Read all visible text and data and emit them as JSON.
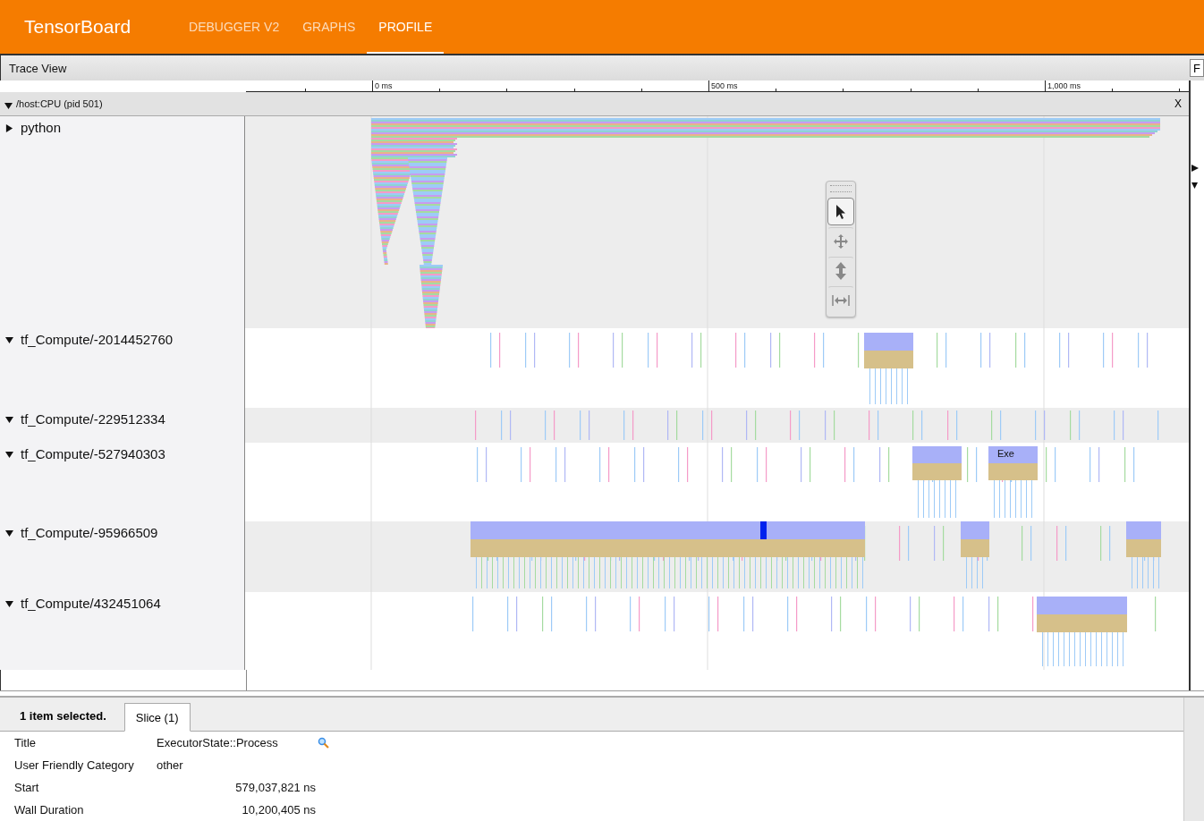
{
  "app": {
    "title": "TensorBoard",
    "tabs": [
      {
        "label": "DEBUGGER V2",
        "selected": false
      },
      {
        "label": "GRAPHS",
        "selected": false
      },
      {
        "label": "PROFILE",
        "selected": true
      }
    ]
  },
  "trace_view": {
    "title": "Trace View",
    "side_button": "F",
    "ruler_ticks": [
      "0 ms",
      "500 ms",
      "1,000 ms"
    ],
    "process": {
      "label": "/host:CPU (pid 501)",
      "expanded": true,
      "close": "X"
    },
    "threads": [
      {
        "name": "python",
        "expanded": false
      },
      {
        "name": "tf_Compute/-2014452760",
        "expanded": true
      },
      {
        "name": "tf_Compute/-229512334",
        "expanded": true
      },
      {
        "name": "tf_Compute/-527940303",
        "expanded": true,
        "slice_label": "Exe"
      },
      {
        "name": "tf_Compute/-95966509",
        "expanded": true
      },
      {
        "name": "tf_Compute/432451064",
        "expanded": true
      }
    ],
    "tools": [
      {
        "kind": "select",
        "selected": true
      },
      {
        "kind": "pan",
        "selected": false
      },
      {
        "kind": "zoom",
        "selected": false
      },
      {
        "kind": "timing",
        "selected": false
      }
    ]
  },
  "selection": {
    "summary": "1 item selected.",
    "tabs": [
      {
        "label": "Slice (1)",
        "selected": true
      }
    ],
    "rows": [
      {
        "kind": "title",
        "label": "Title",
        "value": "ExecutorState::Process"
      },
      {
        "kind": "text",
        "label": "User Friendly Category",
        "value": "other"
      },
      {
        "kind": "number",
        "label": "Start",
        "value": "579,037,821 ns"
      },
      {
        "kind": "number",
        "label": "Wall Duration",
        "value": "10,200,405 ns"
      }
    ]
  }
}
